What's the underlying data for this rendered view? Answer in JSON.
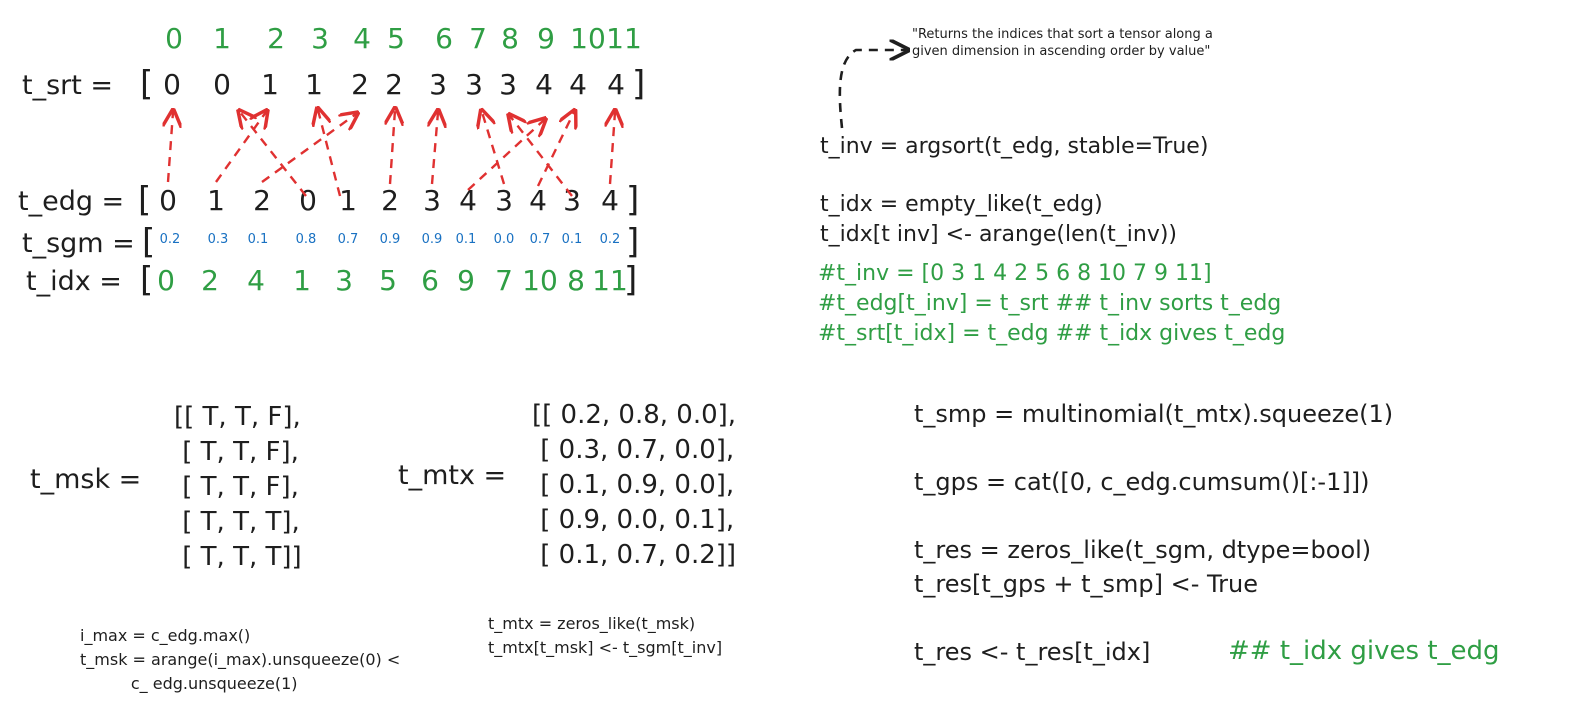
{
  "index_row": [
    "0",
    "1",
    "2",
    "3",
    "4",
    "5",
    "6",
    "7",
    "8",
    "9",
    "10",
    "11"
  ],
  "t_srt": {
    "label": "t_srt = ",
    "values": [
      "0",
      "0",
      "1",
      "1",
      "2",
      "2",
      "3",
      "3",
      "3",
      "4",
      "4",
      "4"
    ]
  },
  "t_edg": {
    "label": "t_edg = ",
    "values": [
      "0",
      "1",
      "2",
      "0",
      "1",
      "2",
      "3",
      "4",
      "3",
      "4",
      "3",
      "4"
    ]
  },
  "t_sgm": {
    "label": "t_sgm = ",
    "values": [
      "0.2",
      "0.3",
      "0.1",
      "0.8",
      "0.7",
      "0.9",
      "0.9",
      "0.1",
      "0.0",
      "0.7",
      "0.1",
      "0.2"
    ]
  },
  "t_idx": {
    "label": "t_idx = ",
    "values": [
      "0",
      "2",
      "4",
      "1",
      "3",
      "5",
      "6",
      "9",
      "7",
      "10",
      "8",
      "11"
    ]
  },
  "argsort_comment": "\"Returns the indices that sort a tensor along a given dimension in ascending order by value\"",
  "right_code": [
    "t_inv = argsort(t_edg, stable=True)",
    "t_idx = empty_like(t_edg)",
    "t_idx[t inv] <- arange(len(t_inv))"
  ],
  "right_comments": [
    "#t_inv = [0 3 1 4 2 5 6 8 10 7 9 11]",
    "#t_edg[t_inv] = t_srt ## t_inv sorts t_edg",
    "#t_srt[t_idx] = t_edg ## t_idx gives t_edg"
  ],
  "t_msk": {
    "label": "t_msk = ",
    "rows": [
      "[[ T, T, F],",
      " [ T, T, F],",
      " [ T, T, F],",
      " [ T, T, T],",
      " [ T, T, T]]"
    ]
  },
  "t_mtx": {
    "label": "t_mtx = ",
    "rows": [
      "[[ 0.2, 0.8, 0.0],",
      " [ 0.3, 0.7, 0.0],",
      " [ 0.1, 0.9, 0.0],",
      " [ 0.9, 0.0, 0.1],",
      " [ 0.1, 0.7, 0.2]]"
    ]
  },
  "mask_code": [
    "i_max = c_edg.max()",
    "t_msk = arange(i_max).unsqueeze(0) <",
    "          c_ edg.unsqueeze(1)"
  ],
  "mtx_code": [
    "t_mtx = zeros_like(t_msk)",
    "t_mtx[t_msk] <- t_sgm[t_inv]"
  ],
  "sample_code": [
    "t_smp = multinomial(t_mtx).squeeze(1)",
    "t_gps = cat([0, c_edg.cumsum()[:-1]])",
    "t_res = zeros_like(t_sgm, dtype=bool)",
    "t_res[t_gps + t_smp] <- True",
    "t_res <- t_res[t_idx]"
  ],
  "sample_comment": "## t_idx gives t_edg",
  "colors": {
    "ink": "#1e1e1e",
    "green": "#2f9e44",
    "blue": "#1971c2",
    "arrow": "#e03131"
  },
  "icons": [
    "red-dashed-arrow",
    "black-dashed-arrow"
  ]
}
